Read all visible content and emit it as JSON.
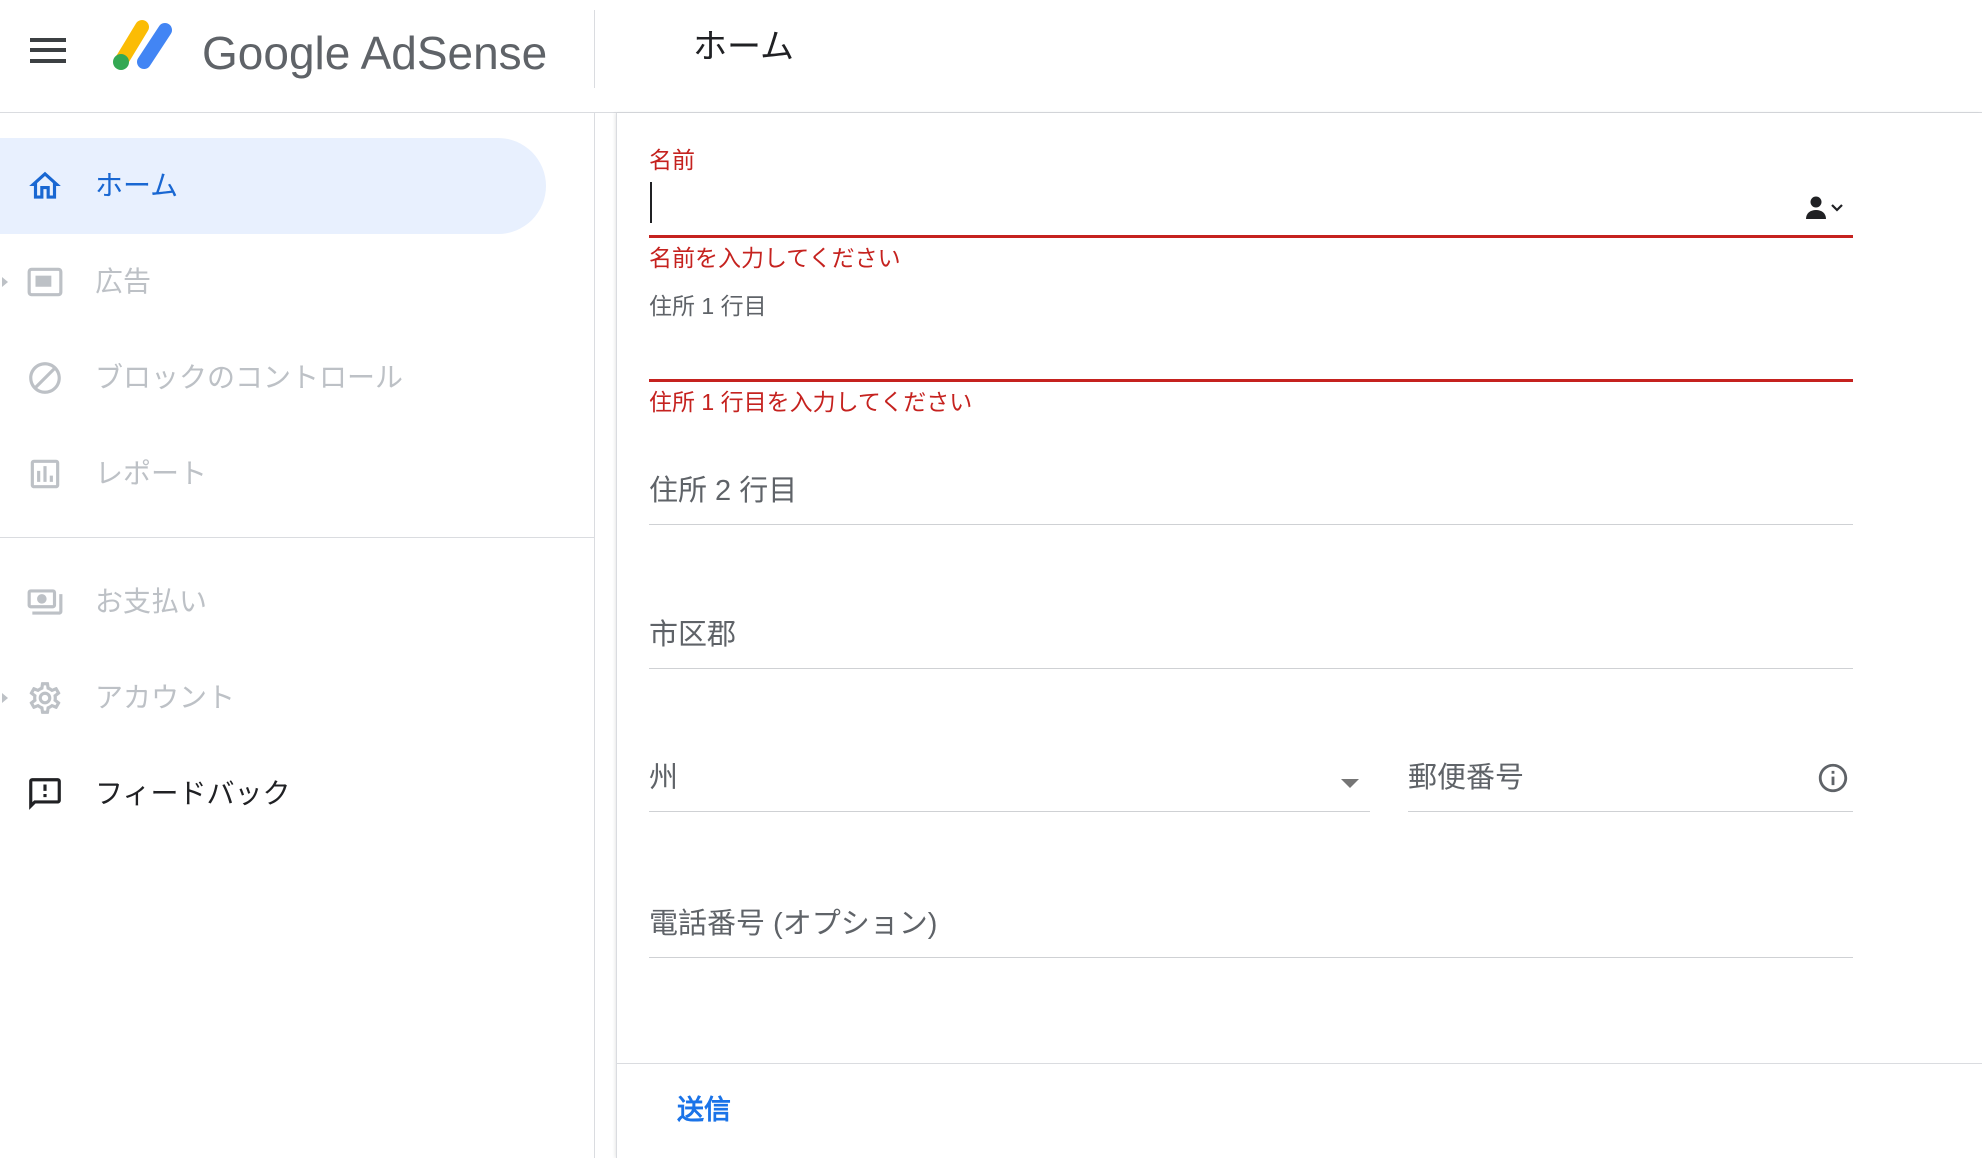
{
  "header": {
    "menu_icon": "menu-icon",
    "logo_icon": "adsense-logo-icon",
    "brand_name": "Google AdSense",
    "page_title": "ホーム"
  },
  "sidebar": {
    "primary": [
      {
        "label": "ホーム",
        "icon": "home-icon",
        "active": true,
        "disabled": false
      },
      {
        "label": "広告",
        "icon": "ads-icon",
        "active": false,
        "disabled": true,
        "expandable": true
      },
      {
        "label": "ブロックのコントロール",
        "icon": "block-icon",
        "active": false,
        "disabled": true
      },
      {
        "label": "レポート",
        "icon": "reports-icon",
        "active": false,
        "disabled": true
      }
    ],
    "secondary": [
      {
        "label": "お支払い",
        "icon": "payments-icon",
        "active": false,
        "disabled": true
      },
      {
        "label": "アカウント",
        "icon": "settings-icon",
        "active": false,
        "disabled": true,
        "expandable": true
      },
      {
        "label": "フィードバック",
        "icon": "feedback-icon",
        "active": false,
        "disabled": false
      }
    ]
  },
  "form": {
    "name": {
      "label": "名前",
      "value": "",
      "focused": true,
      "icon": "contact-picker-icon",
      "error": "名前を入力してください"
    },
    "address_line1": {
      "label": "住所 1 行目",
      "value": "",
      "error": "住所 1 行目を入力してください"
    },
    "address_line2": {
      "label": "住所 2 行目",
      "value": ""
    },
    "city": {
      "label": "市区郡",
      "value": ""
    },
    "state": {
      "label": "州",
      "value": "",
      "icon": "dropdown-arrow-icon"
    },
    "postal_code": {
      "label": "郵便番号",
      "value": "",
      "icon": "info-icon"
    },
    "phone": {
      "label": "電話番号 (オプション)",
      "value": ""
    }
  },
  "actions": {
    "submit_label": "送信"
  },
  "colors": {
    "accent": "#1967d2",
    "active_nav_background": "#e8f0fe",
    "error": "#c5221f",
    "text_primary": "#202124",
    "text_secondary": "#5f6368",
    "text_disabled": "#bdc1c6",
    "divider": "#dadce0",
    "action": "#1a73e8",
    "logo_yellow": "#fbbc04",
    "logo_blue": "#4285f4",
    "logo_green": "#34a853"
  }
}
